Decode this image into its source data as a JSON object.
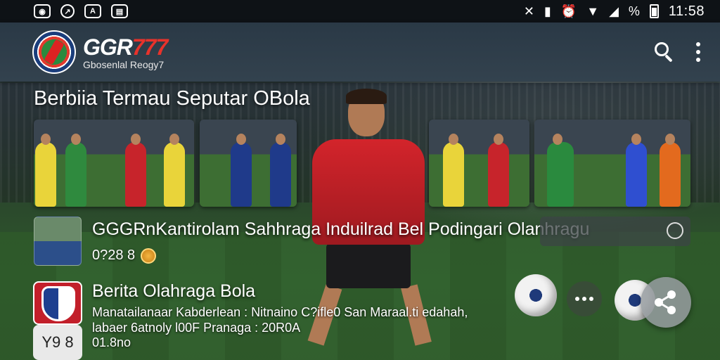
{
  "status_bar": {
    "time": "11:58",
    "battery_percent": "%",
    "left_icons": [
      "notification-icon",
      "app-icon",
      "app-icon",
      "gallery-icon"
    ],
    "right_icons": [
      "mute-icon",
      "vibrate-icon",
      "alarm-icon",
      "wifi-icon",
      "signal-icon",
      "battery-icon"
    ]
  },
  "app_bar": {
    "brand_name_main": "GGR",
    "brand_name_accent": "777",
    "brand_subtitle": "Gbosenlal Reogy7",
    "actions": [
      "search-icon",
      "more-icon"
    ]
  },
  "section": {
    "title": "Berbiia Termau Seputar OBola"
  },
  "carousel": {
    "card_count": 4
  },
  "list": {
    "item_1": {
      "title": "GGGRnKantirolam Sahhraga Induilrad Bel Podingari Olanhragu",
      "meta": "0?28 8"
    },
    "item_2": {
      "title": "Berita Olahraga Bola",
      "description_line_1": "Manatailanaar Kabderlean : Nitnaino C?ifle0 San Maraal.ti edahah,",
      "description_line_2": "labaer 6atnoly l00F Pranaga : 20R0A",
      "date": "01.8no",
      "badge": "Y9 8"
    }
  },
  "colors": {
    "status_bar": "#0e1216",
    "app_bar": "#2a3946",
    "brand_accent": "#e8322b",
    "share_fab": "#969ca0"
  }
}
